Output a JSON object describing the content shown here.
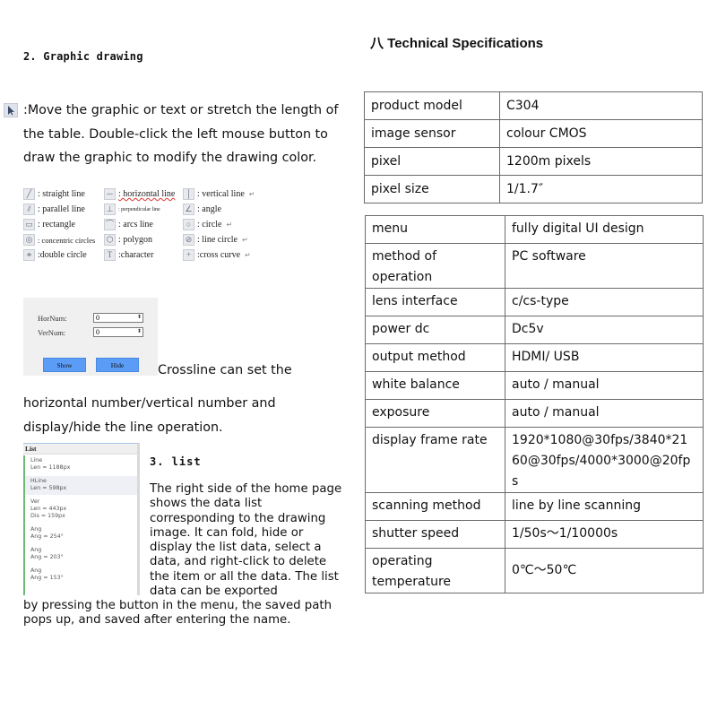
{
  "left": {
    "graphic_section_title": "2. Graphic drawing",
    "pointer_icon": "pointer-arrow-icon",
    "move_description": ":Move the graphic or text or stretch the length of the table. Double-click the left mouse button to draw the graphic to modify the drawing color.",
    "tools": [
      [
        {
          "icon": "straight-line-icon",
          "glyph": "╱",
          "label": ": straight line"
        },
        {
          "icon": "horizontal-line-icon",
          "glyph": "─",
          "label": ": horizontal line"
        },
        {
          "icon": "vertical-line-icon",
          "glyph": "│",
          "label": ": vertical line"
        }
      ],
      [
        {
          "icon": "parallel-line-icon",
          "glyph": "⫽",
          "label": ":  parallel line"
        },
        {
          "icon": "perpendicular-line-icon",
          "glyph": "⊥",
          "label": ": perpendicular line"
        },
        {
          "icon": "angle-icon",
          "glyph": "∠",
          "label": ":  angle"
        }
      ],
      [
        {
          "icon": "rectangle-icon",
          "glyph": "▭",
          "label": ":  rectangle"
        },
        {
          "icon": "arcs-line-icon",
          "glyph": "⌒",
          "label": ":  arcs line"
        },
        {
          "icon": "circle-icon",
          "glyph": "○",
          "label": ":  circle"
        }
      ],
      [
        {
          "icon": "concentric-circles-icon",
          "glyph": "◎",
          "label": ":  concentric circles"
        },
        {
          "icon": "polygon-icon",
          "glyph": "⬡",
          "label": ":  polygon"
        },
        {
          "icon": "line-circle-icon",
          "glyph": "⊘",
          "label": ":  line circle"
        }
      ],
      [
        {
          "icon": "double-circle-icon",
          "glyph": "⚭",
          "label": ":double circle"
        },
        {
          "icon": "character-icon",
          "glyph": "T",
          "label": ":character"
        },
        {
          "icon": "cross-curve-icon",
          "glyph": "+",
          "label": ":cross curve"
        }
      ]
    ],
    "crossline": {
      "hornum_label": "HorNum:",
      "hornum_value": "0",
      "vernum_label": "VerNum:",
      "vernum_value": "0",
      "show_label": "Show",
      "hide_label": "Hide",
      "spin_glyph": "⬍",
      "description_1": "Crossline can set the",
      "description_2": "horizontal number/vertical number and display/hide the line operation."
    },
    "list_panel": {
      "header": "List",
      "items": [
        {
          "name": "Line",
          "lines": [
            "Len = 1188px"
          ]
        },
        {
          "name": "HLine",
          "lines": [
            "Len = 598px"
          ],
          "selected": true
        },
        {
          "name": "Ver",
          "lines": [
            "Len = 443px",
            "Dis = 159px"
          ]
        },
        {
          "name": "Ang",
          "lines": [
            "Ang = 254°"
          ]
        },
        {
          "name": "Ang",
          "lines": [
            "Ang = 203°"
          ]
        },
        {
          "name": "Ang",
          "lines": [
            "Ang = 153°"
          ]
        }
      ]
    },
    "list_section_title": "3. list",
    "list_description": "The right side of the home page shows the data list corresponding to the drawing image. It can fold, hide or display the list data, select a data, and right-click to delete the item or all the data. The list data can be exported",
    "list_description_cont": "by pressing the button in the menu, the saved path pops up, and saved after entering the name."
  },
  "specs": {
    "title": "八 Technical Specifications",
    "table_1": [
      {
        "key": "product model",
        "value": "C304"
      },
      {
        "key": "image sensor",
        "value": "colour CMOS"
      },
      {
        "key": "pixel",
        "value": "1200m pixels"
      },
      {
        "key": "pixel size",
        "value": "1/1.7″"
      }
    ],
    "table_2": [
      {
        "key": "menu",
        "value": "fully digital UI design"
      },
      {
        "key": "method of operation",
        "value": "PC software"
      },
      {
        "key": "lens interface",
        "value": "c/cs-type"
      },
      {
        "key": "power dc",
        "value": "Dc5v"
      },
      {
        "key": "output method",
        "value": "HDMI/ USB"
      },
      {
        "key": "white balance",
        "value": "auto / manual"
      },
      {
        "key": "exposure",
        "value": "auto / manual"
      },
      {
        "key": "display frame rate",
        "value": "1920*1080@30fps/3840*2160@30fps/4000*3000@20fps"
      },
      {
        "key": "scanning method",
        "value": "line by line scanning"
      },
      {
        "key": "shutter speed",
        "value": "1/50s～1/10000s"
      },
      {
        "key": "operating temperature",
        "value": "0℃～50℃"
      }
    ]
  }
}
